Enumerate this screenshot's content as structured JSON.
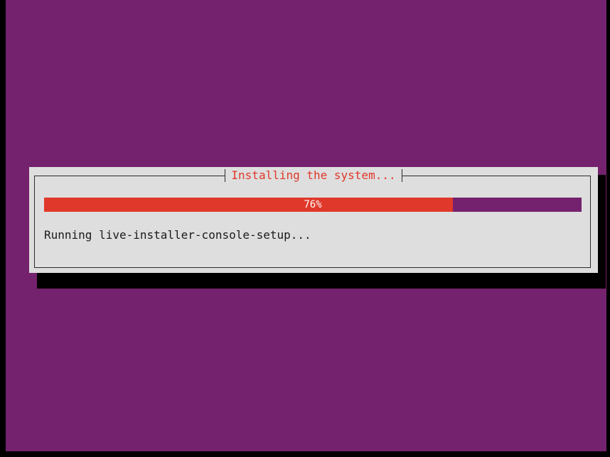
{
  "dialog": {
    "title": "Installing the system...",
    "status": "Running live-installer-console-setup..."
  },
  "progress": {
    "percent": 76,
    "label": "76%"
  },
  "colors": {
    "background": "#74226e",
    "dialog": "#dedede",
    "accent": "#e0382a",
    "shadow": "#000000"
  }
}
